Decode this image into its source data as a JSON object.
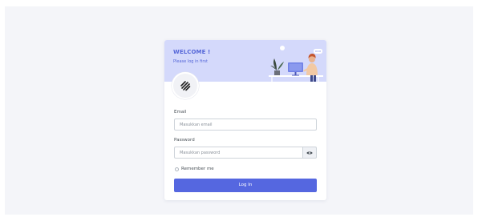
{
  "header": {
    "welcome": "WELCOME !",
    "subtitle": "Please log in first"
  },
  "form": {
    "email_label": "Email",
    "email_placeholder": "Masukkan email",
    "password_label": "Password",
    "password_placeholder": "Masukkan password",
    "remember_label": "Remember me",
    "login_label": "Log In"
  },
  "icons": {
    "logo": "hatched-logo-icon",
    "show_password": "eye-icon",
    "illustration": "person-at-desk-illustration"
  },
  "colors": {
    "background": "#f4f5f9",
    "banner": "#d4d9fb",
    "accent": "#5567e0",
    "accent_text": "#5566d8"
  }
}
